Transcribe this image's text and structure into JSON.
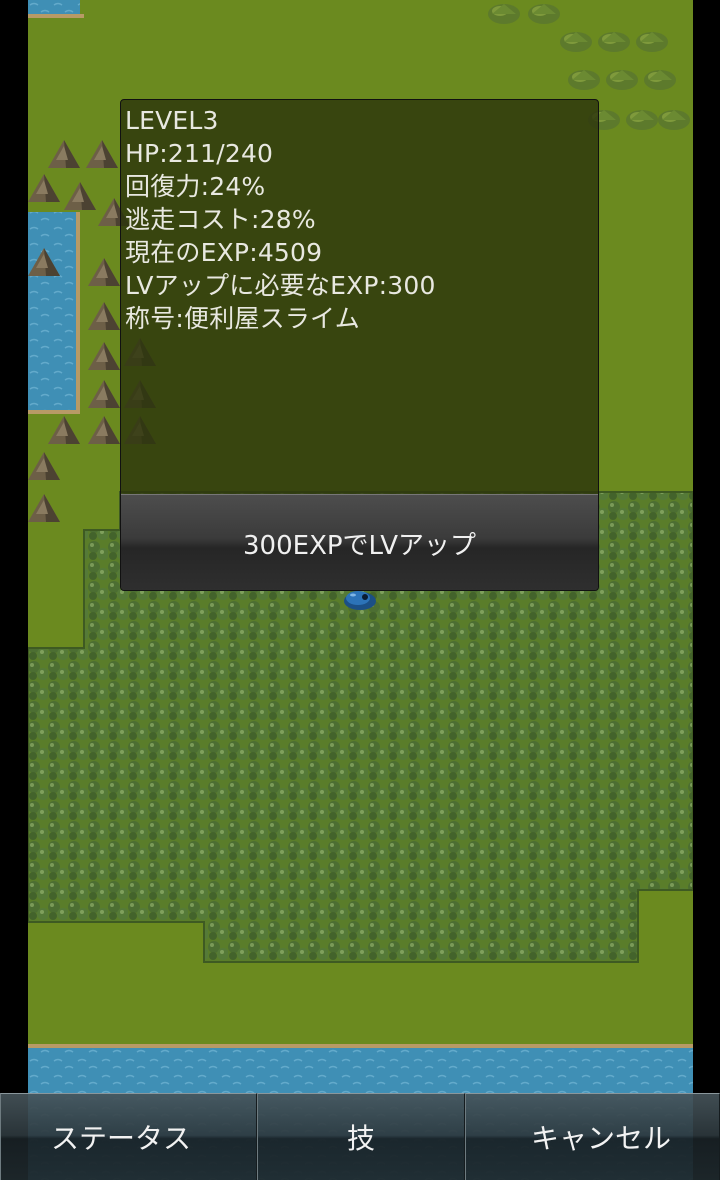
{
  "status": {
    "level": "LEVEL3",
    "hp": "HP:211/240",
    "recovery": "回復力:24%",
    "escape_cost": "逃走コスト:28%",
    "current_exp": "現在のEXP:4509",
    "exp_needed": "LVアップに必要なEXP:300",
    "title": "称号:便利屋スライム"
  },
  "levelup_button_label": "300EXPでLVアップ",
  "menu": {
    "status_label": "ステータス",
    "skill_label": "技",
    "cancel_label": "キャンセル"
  },
  "colors": {
    "grass": "#6b8a1f",
    "water": "#3f8fb5",
    "forest": "#4f7030",
    "window_bg": "#2d360c"
  }
}
